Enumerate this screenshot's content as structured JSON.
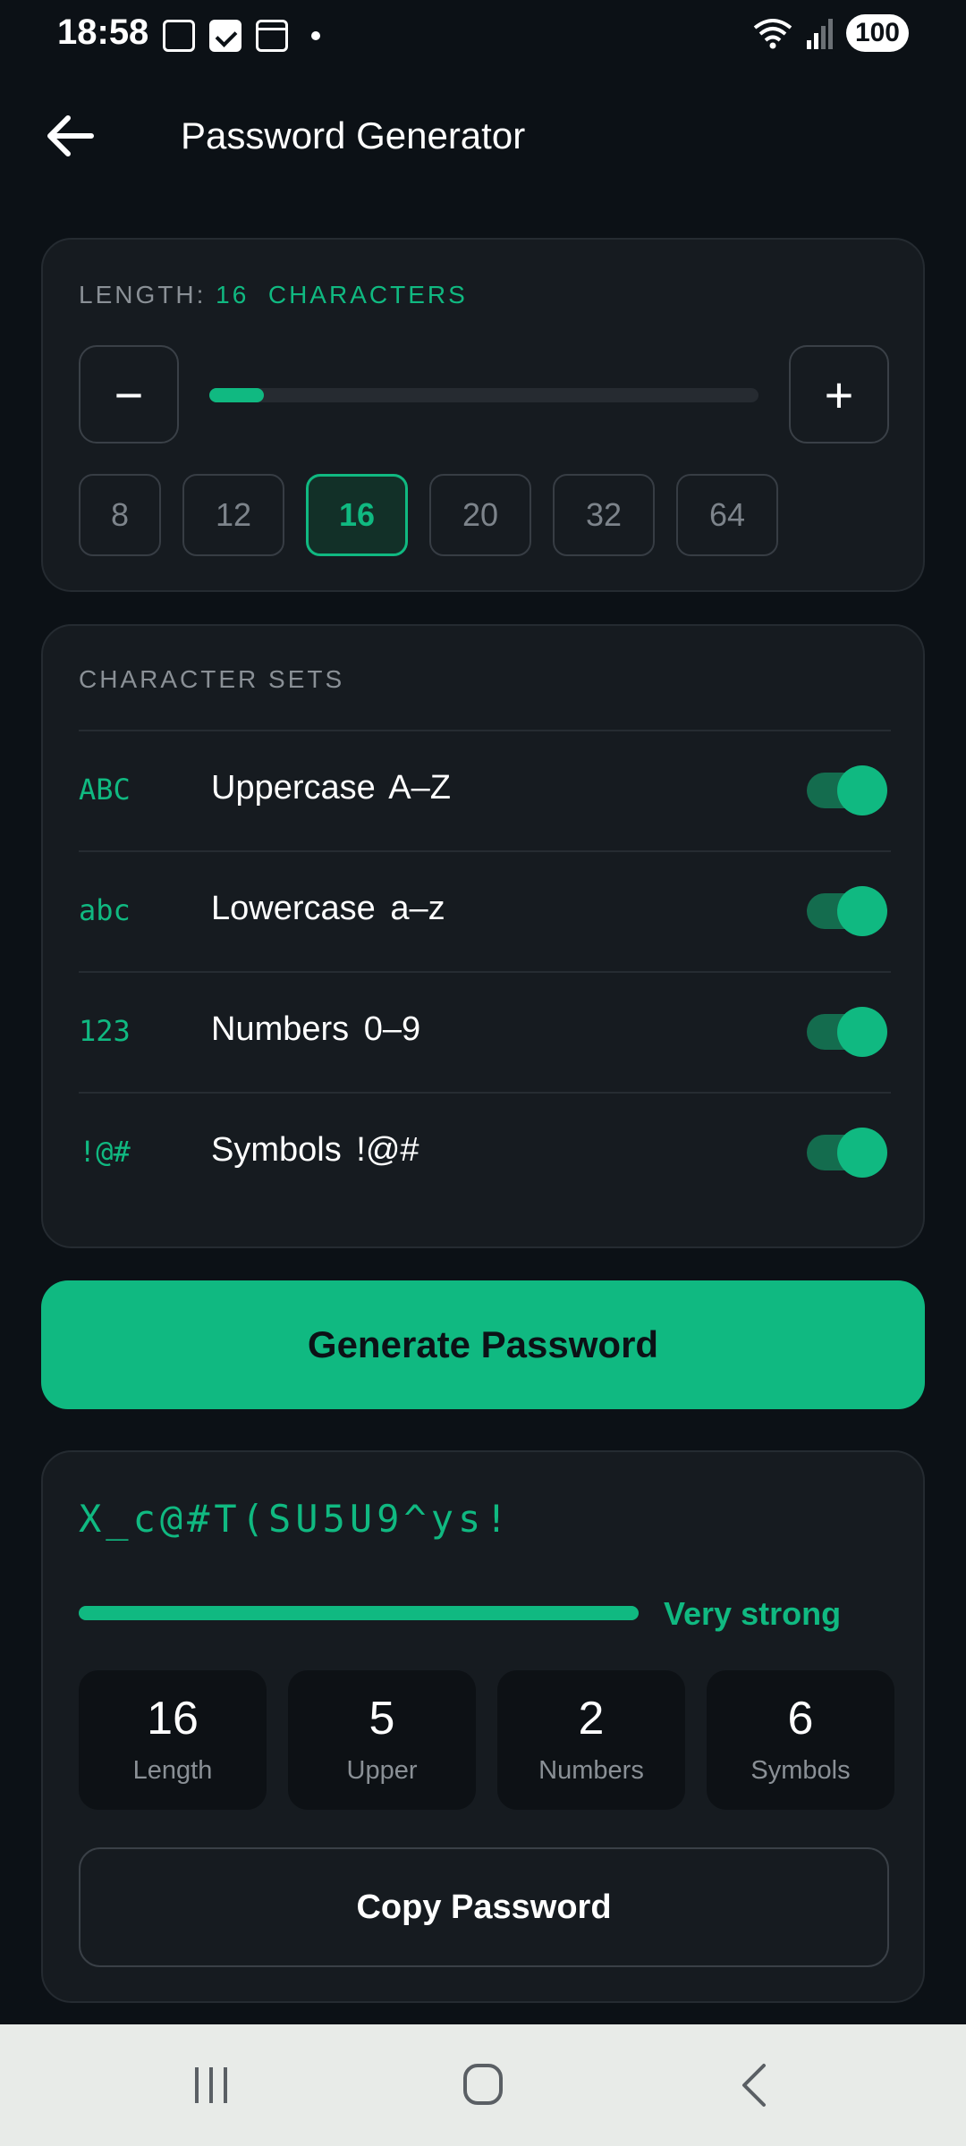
{
  "status_bar": {
    "time": "18:58",
    "battery": "100"
  },
  "app_bar": {
    "title": "Password Generator"
  },
  "length": {
    "label_prefix": "LENGTH: ",
    "value": "16",
    "unit": "CHARACTERS",
    "minus": "−",
    "plus": "+",
    "slider_fraction": 0.1,
    "presets": [
      "8",
      "12",
      "16",
      "20",
      "32",
      "64"
    ],
    "active_preset": "16"
  },
  "character_sets": {
    "label": "CHARACTER SETS",
    "items": [
      {
        "glyph": "ABC",
        "name": "Uppercase  A–Z",
        "enabled": true
      },
      {
        "glyph": "abc",
        "name": "Lowercase  a–z",
        "enabled": true
      },
      {
        "glyph": "123",
        "name": "Numbers  0–9",
        "enabled": true
      },
      {
        "glyph": "!@#",
        "name": "Symbols  !@#",
        "enabled": true
      }
    ]
  },
  "generate_label": "Generate Password",
  "result": {
    "password": "X_c@#T(SU5U9^ys!",
    "strength_label": "Very strong",
    "strength_fraction": 1.0,
    "stats": [
      {
        "value": "16",
        "label": "Length"
      },
      {
        "value": "5",
        "label": "Upper"
      },
      {
        "value": "2",
        "label": "Numbers"
      },
      {
        "value": "6",
        "label": "Symbols"
      }
    ],
    "copy_label": "Copy Password"
  },
  "colors": {
    "accent": "#10b981",
    "background": "#0c1116",
    "card": "#161b20"
  }
}
